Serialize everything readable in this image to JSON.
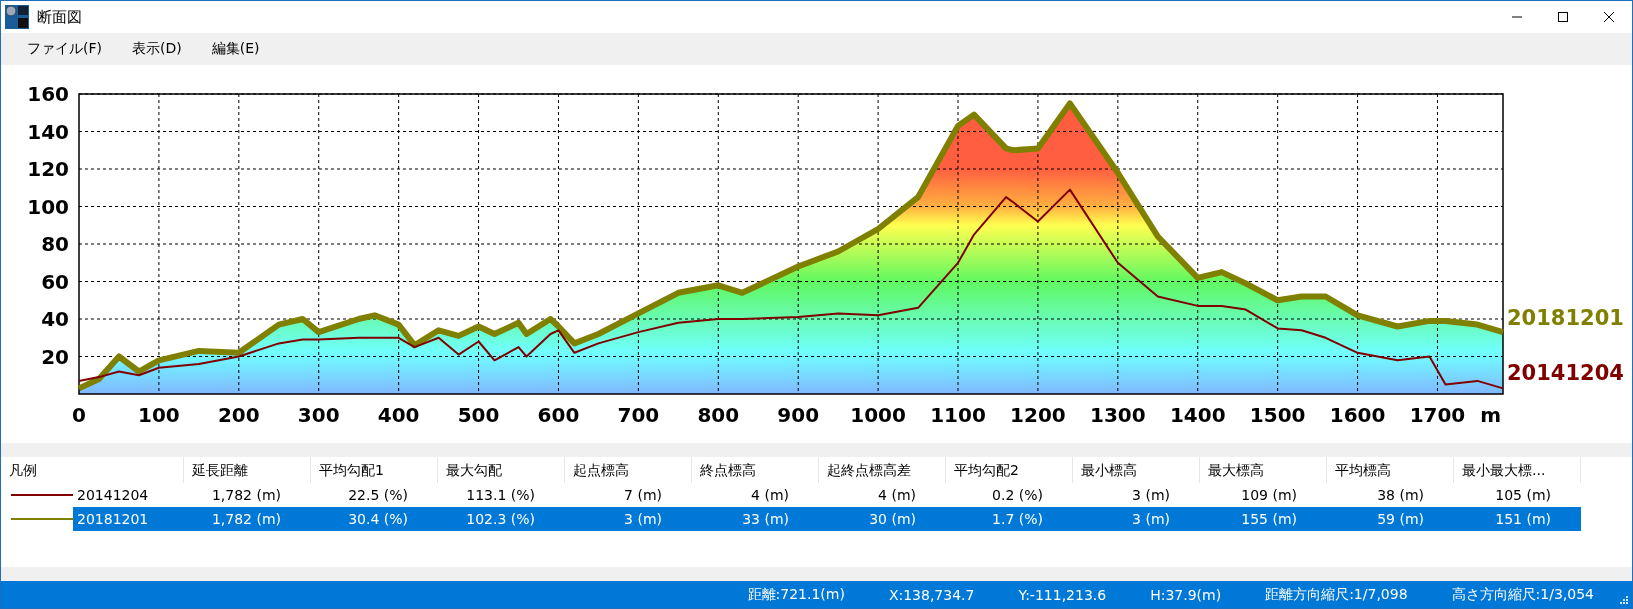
{
  "window": {
    "title": "断面図"
  },
  "menu": [
    "ファイル(F)",
    "表示(D)",
    "編集(E)"
  ],
  "chart": {
    "chart_data": {
      "type": "line",
      "grid": true,
      "xlabel": "m",
      "xlim": [
        0,
        1782
      ],
      "ylim": [
        0,
        160
      ],
      "xticks": [
        0,
        100,
        200,
        300,
        400,
        500,
        600,
        700,
        800,
        900,
        1000,
        1100,
        1200,
        1300,
        1400,
        1500,
        1600,
        1700
      ],
      "yticks": [
        20,
        40,
        60,
        80,
        100,
        120,
        140,
        160
      ],
      "x": [
        0,
        25,
        50,
        75,
        100,
        150,
        200,
        250,
        280,
        300,
        350,
        370,
        400,
        420,
        450,
        475,
        500,
        520,
        550,
        560,
        590,
        600,
        620,
        650,
        700,
        750,
        800,
        830,
        900,
        950,
        1000,
        1050,
        1100,
        1120,
        1160,
        1170,
        1200,
        1240,
        1300,
        1350,
        1400,
        1430,
        1460,
        1500,
        1530,
        1560,
        1600,
        1650,
        1690,
        1710,
        1750,
        1782
      ],
      "series": [
        {
          "name": "20181201",
          "type": "area",
          "color": "#808000",
          "values": [
            3,
            8,
            20,
            12,
            18,
            23,
            22,
            37,
            40,
            33,
            40,
            42,
            37,
            26,
            34,
            31,
            36,
            32,
            38,
            32,
            40,
            36,
            27,
            32,
            43,
            54,
            58,
            54,
            68,
            76,
            88,
            105,
            143,
            149,
            131,
            130,
            131,
            155,
            118,
            84,
            62,
            65,
            59,
            50,
            52,
            52,
            42,
            36,
            39,
            39,
            37,
            33
          ]
        },
        {
          "name": "20141204",
          "type": "line",
          "color": "#800000",
          "values": [
            7,
            9,
            12,
            10,
            14,
            16,
            20,
            27,
            29,
            29,
            30,
            30,
            30,
            25,
            30,
            21,
            28,
            18,
            25,
            20,
            32,
            34,
            22,
            27,
            33,
            38,
            40,
            40,
            41,
            43,
            42,
            46,
            70,
            85,
            105,
            102,
            92,
            109,
            70,
            52,
            47,
            47,
            45,
            35,
            34,
            30,
            22,
            18,
            20,
            5,
            7,
            3
          ]
        }
      ]
    }
  },
  "legend_table": {
    "columns": [
      "凡例",
      "延長距離",
      "平均勾配1",
      "最大勾配",
      "起点標高",
      "終点標高",
      "起終点標高差",
      "平均勾配2",
      "最小標高",
      "最大標高",
      "平均標高",
      "最小最大標..."
    ],
    "rows": [
      {
        "color": "#800000",
        "selected": false,
        "cells": [
          "20141204",
          "1,782 (m)",
          "22.5 (%)",
          "113.1 (%)",
          "7 (m)",
          "4 (m)",
          "4 (m)",
          "0.2 (%)",
          "3 (m)",
          "109 (m)",
          "38 (m)",
          "105 (m)"
        ]
      },
      {
        "color": "#808000",
        "selected": true,
        "cells": [
          "20181201",
          "1,782 (m)",
          "30.4 (%)",
          "102.3 (%)",
          "3 (m)",
          "33 (m)",
          "30 (m)",
          "1.7 (%)",
          "3 (m)",
          "155 (m)",
          "59 (m)",
          "151 (m)"
        ]
      }
    ]
  },
  "status_bar": [
    "距離:721.1(m)",
    "X:138,734.7",
    "Y:-111,213.6",
    "H:37.9(m)",
    "距離方向縮尺:1/7,098",
    "高さ方向縮尺:1/3,054"
  ]
}
